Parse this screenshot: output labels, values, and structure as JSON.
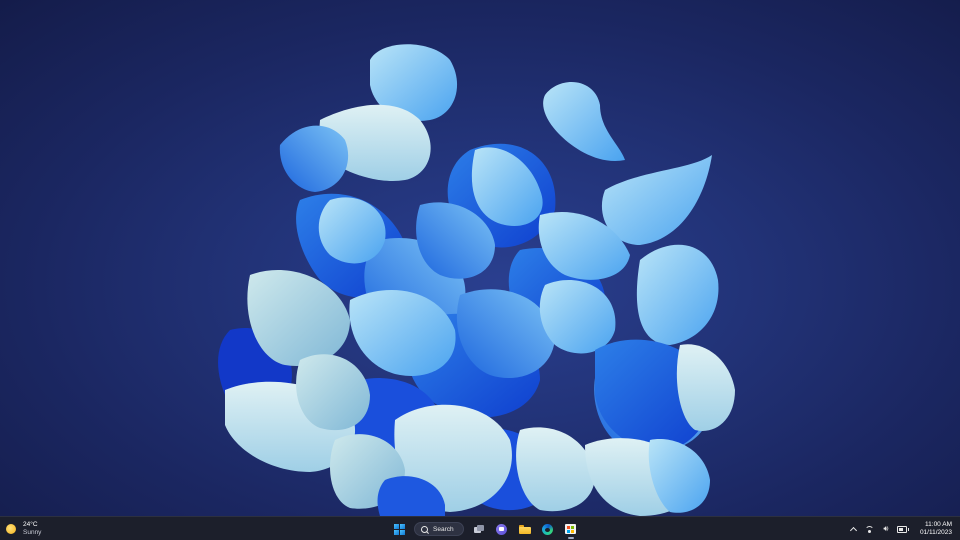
{
  "wallpaper": {
    "description_icon": "blue-bloom-wallpaper",
    "bg_color": "#1b2762",
    "petal_colors": [
      "#0f3fcf",
      "#1a5fe0",
      "#2d7fe8",
      "#4aa3f0",
      "#7cc3f5",
      "#a8dcf6",
      "#c9ecf3",
      "#d9e6ea"
    ]
  },
  "taskbar": {
    "weather": {
      "icon": "sun-icon",
      "temperature": "24°C",
      "condition": "Sunny"
    },
    "start_icon": "windows-start-icon",
    "search": {
      "icon": "search-icon",
      "label": "Search"
    },
    "pinned": [
      {
        "name": "task-view",
        "icon": "task-view-icon"
      },
      {
        "name": "teams-chat",
        "icon": "chat-icon"
      },
      {
        "name": "file-explorer",
        "icon": "folder-icon"
      },
      {
        "name": "edge",
        "icon": "edge-icon"
      },
      {
        "name": "microsoft-store",
        "icon": "store-icon"
      }
    ],
    "tray": {
      "icons": [
        "chevron-up-icon",
        "wifi-icon",
        "volume-icon",
        "battery-icon"
      ],
      "time": "11:00 AM",
      "date": "01/11/2023"
    }
  }
}
